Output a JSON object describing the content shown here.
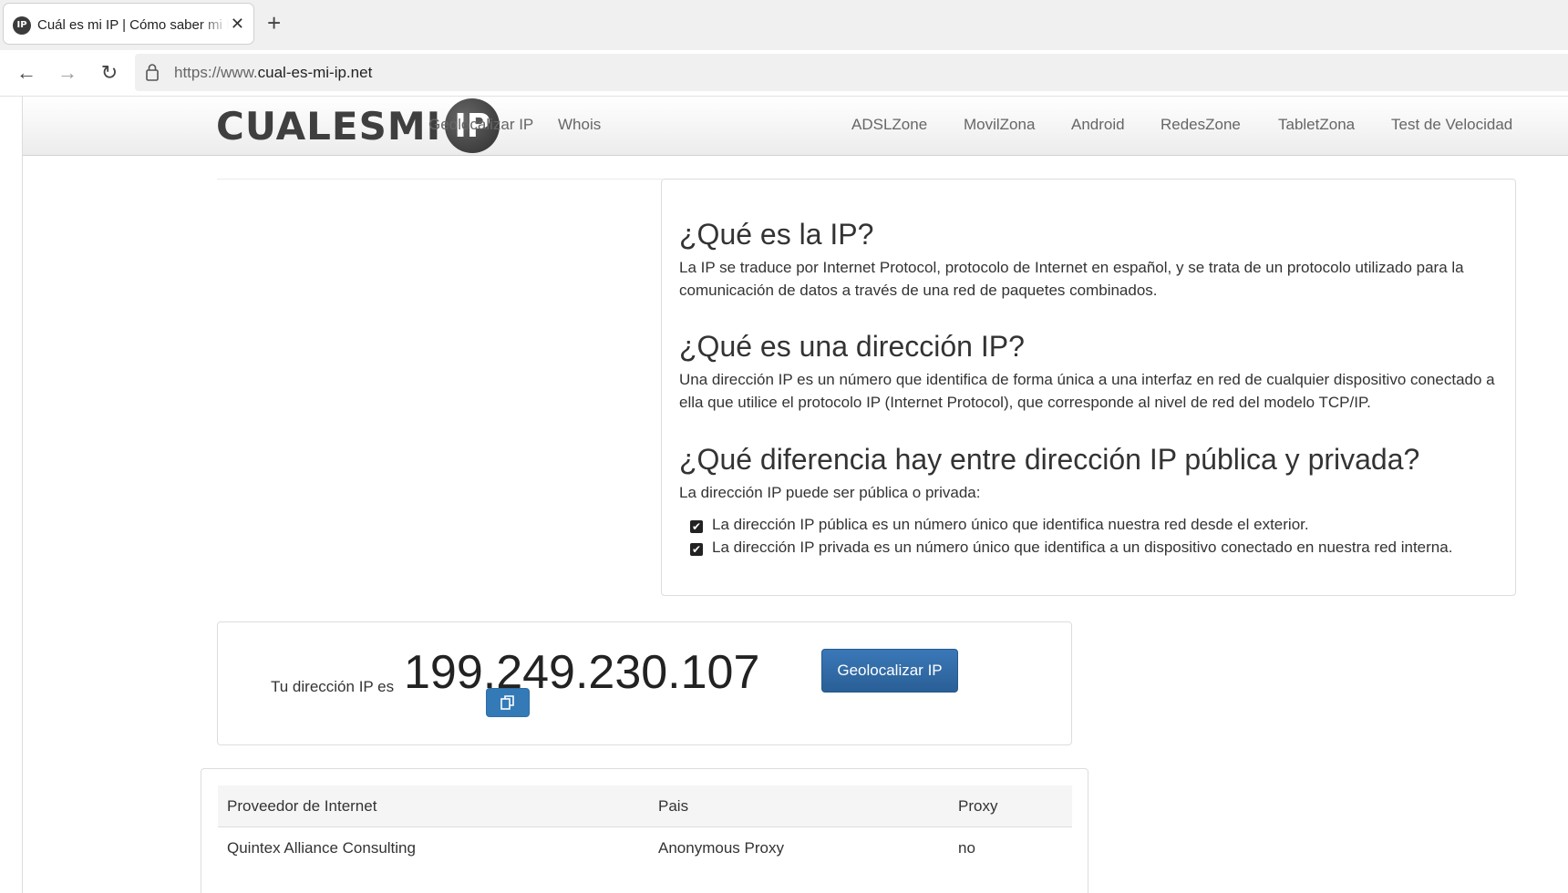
{
  "browser": {
    "tab": {
      "favicon_text": "IP",
      "title": "Cuál es mi IP | Cómo saber mi IP",
      "close_glyph": "✕"
    },
    "new_tab_glyph": "+",
    "nav": {
      "back": "←",
      "forward": "→",
      "reload": "↻"
    },
    "url_scheme": "https://www.",
    "url_host": "cual-es-mi-ip.net"
  },
  "site": {
    "logo": {
      "word": "CUALESMI",
      "circle": "IP"
    },
    "nav_left": [
      "Geolocalizar IP",
      "Whois"
    ],
    "nav_right": [
      "ADSLZone",
      "MovilZona",
      "Android",
      "RedesZone",
      "TabletZona",
      "Test de Velocidad"
    ]
  },
  "info": {
    "h1": "¿Qué es la IP?",
    "p1": "La IP se traduce por Internet Protocol, protocolo de Internet en español, y se trata de un protocolo utilizado para la comunicación de datos a través de una red de paquetes combinados.",
    "h2": "¿Qué es una dirección IP?",
    "p2": "Una dirección IP es un número que identifica de forma única a una interfaz en red de cualquier dispositivo conectado a ella que utilice el protocolo IP (Internet Protocol), que corresponde al nivel de red del modelo TCP/IP.",
    "h3": "¿Qué diferencia hay entre dirección IP pública y privada?",
    "p3": "La dirección IP puede ser pública o privada:",
    "checks": [
      "La dirección IP pública es un número único que identifica nuestra red desde el exterior.",
      "La dirección IP privada es un número único que identifica a un dispositivo conectado en nuestra red interna."
    ],
    "check_glyph": "✔"
  },
  "ip_panel": {
    "label": "Tu dirección IP es",
    "ip": "199.249.230.107",
    "geo_button": "Geolocalizar IP"
  },
  "table": {
    "headers": [
      "Proveedor de Internet",
      "Pais",
      "Proxy"
    ],
    "row": [
      "Quintex Alliance Consulting",
      "Anonymous Proxy",
      "no"
    ]
  },
  "colors": {
    "button_blue": "#337ab7",
    "nav_text": "#666666",
    "text": "#333333"
  }
}
